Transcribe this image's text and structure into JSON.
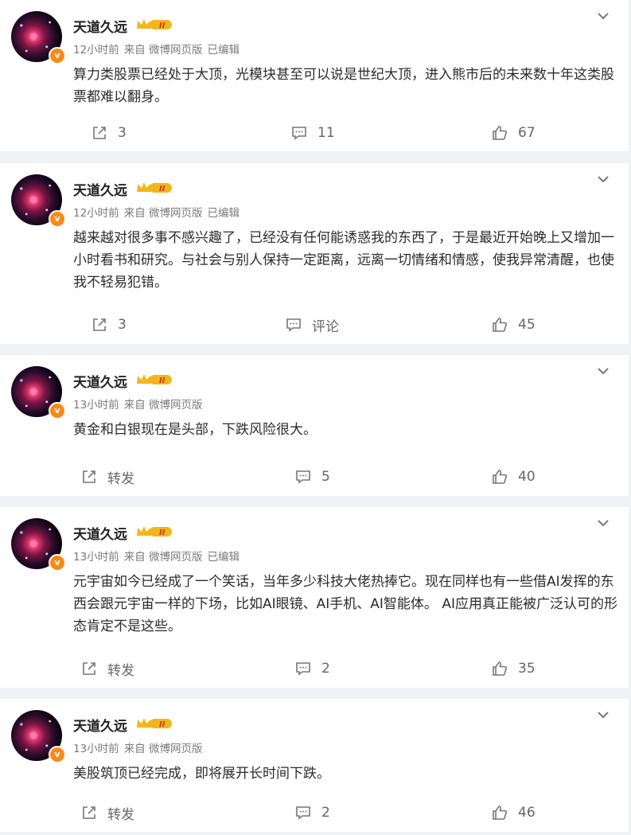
{
  "posts": [
    {
      "author": "天道久远",
      "time": "12小时前",
      "source": "来自 微博网页版",
      "edited": "已编辑",
      "text": "算力类股票已经处于大顶，光模块甚至可以说是世纪大顶，进入熊市后的未来数十年这类股票都难以翻身。",
      "repost": "3",
      "comment": "11",
      "like": "67"
    },
    {
      "author": "天道久远",
      "time": "12小时前",
      "source": "来自 微博网页版",
      "edited": "已编辑",
      "text": "越来越对很多事不感兴趣了，已经没有任何能诱惑我的东西了，于是最近开始晚上又增加一小时看书和研究。与社会与别人保持一定距离，远离一切情绪和情感，使我异常清醒，也使我不轻易犯错。",
      "repost": "3",
      "comment": "评论",
      "like": "45"
    },
    {
      "author": "天道久远",
      "time": "13小时前",
      "source": "来自 微博网页版",
      "edited": "",
      "text": "黄金和白银现在是头部，下跌风险很大。",
      "repost": "转发",
      "comment": "5",
      "like": "40"
    },
    {
      "author": "天道久远",
      "time": "13小时前",
      "source": "来自 微博网页版",
      "edited": "已编辑",
      "text": "元宇宙如今已经成了一个笑话，当年多少科技大佬热捧它。现在同样也有一些借AI发挥的东西会跟元宇宙一样的下场，比如AI眼镜、AI手机、AI智能体。 AI应用真正能被广泛认可的形态肯定不是这些。",
      "repost": "转发",
      "comment": "2",
      "like": "35"
    },
    {
      "author": "天道久远",
      "time": "13小时前",
      "source": "来自 微博网页版",
      "edited": "",
      "text": "美股筑顶已经完成，即将展开长时间下跌。",
      "repost": "转发",
      "comment": "2",
      "like": "46"
    }
  ],
  "icons": {
    "verified_badge": "v",
    "repost": "repost-icon",
    "comment": "comment-icon",
    "like": "like-icon",
    "more": "chevron-down-icon",
    "level": "crown-level-icon"
  },
  "colors": {
    "badge": "#f78a18",
    "crown": "#f2b61c"
  }
}
